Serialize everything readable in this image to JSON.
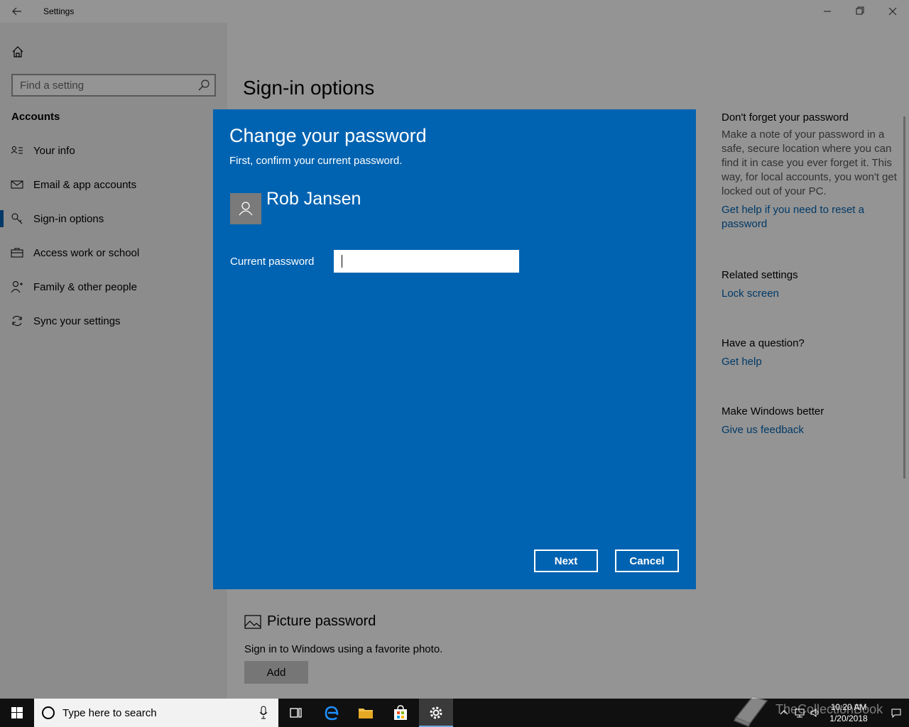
{
  "window": {
    "title": "Settings"
  },
  "sidebar": {
    "search_placeholder": "Find a setting",
    "section_title": "Accounts",
    "items": [
      {
        "label": "Your info",
        "icon": "person-card-icon"
      },
      {
        "label": "Email & app accounts",
        "icon": "mail-icon"
      },
      {
        "label": "Sign-in options",
        "icon": "key-icon",
        "active": true
      },
      {
        "label": "Access work or school",
        "icon": "briefcase-icon"
      },
      {
        "label": "Family & other people",
        "icon": "people-icon"
      },
      {
        "label": "Sync your settings",
        "icon": "sync-icon"
      }
    ]
  },
  "main": {
    "page_title": "Sign-in options",
    "picture_password": {
      "title": "Picture password",
      "description": "Sign in to Windows using a favorite photo.",
      "add_label": "Add"
    },
    "right_column": {
      "password_tip": {
        "heading": "Don't forget your password",
        "body": "Make a note of your password in a safe, secure location where you can find it in case you ever forget it. This way, for local accounts, you won't get locked out of your PC.",
        "link": "Get help if you need to reset a password"
      },
      "related": {
        "heading": "Related settings",
        "link": "Lock screen"
      },
      "question": {
        "heading": "Have a question?",
        "link": "Get help"
      },
      "feedback": {
        "heading": "Make Windows better",
        "link": "Give us feedback"
      }
    }
  },
  "dialog": {
    "title": "Change your password",
    "subtitle": "First, confirm your current password.",
    "user_name": "Rob Jansen",
    "password_label": "Current password",
    "password_value": "",
    "next_label": "Next",
    "cancel_label": "Cancel"
  },
  "taskbar": {
    "search_placeholder": "Type here to search",
    "time": "10:20 AM",
    "date": "1/20/2018",
    "watermark": "TheCollectionBook"
  },
  "colors": {
    "accent": "#0063b1",
    "dialog_bg": "#0063b1",
    "taskbar_bg": "#101010"
  }
}
